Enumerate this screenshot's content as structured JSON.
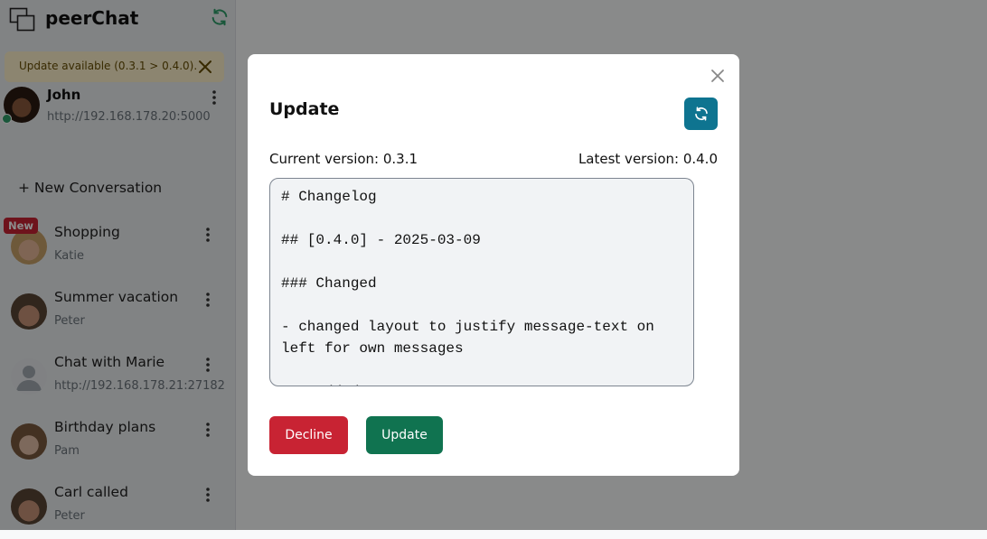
{
  "app": {
    "title": "peerChat"
  },
  "banner": {
    "text": "Update available (0.3.1 > 0.4.0)."
  },
  "profile": {
    "name": "John",
    "url": "http://192.168.178.20:5000"
  },
  "sidebar": {
    "new_conversation": "+ New Conversation",
    "new_badge": "New",
    "conversations": [
      {
        "title": "Shopping",
        "subtitle": "Katie"
      },
      {
        "title": "Summer vacation",
        "subtitle": "Peter"
      },
      {
        "title": "Chat with Marie",
        "subtitle": "http://192.168.178.21:27182"
      },
      {
        "title": "Birthday plans",
        "subtitle": "Pam"
      },
      {
        "title": "Carl called",
        "subtitle": "Peter"
      }
    ]
  },
  "modal": {
    "title": "Update",
    "current_version": "Current version: 0.3.1",
    "latest_version": "Latest version: 0.4.0",
    "changelog": "# Changelog\n\n## [0.4.0] - 2025-03-09\n\n### Changed\n\n- changed layout to justify message-text on left for own messages\n\n### Added",
    "decline_label": "Decline",
    "update_label": "Update"
  },
  "colors": {
    "accent": "#0e7490",
    "decline": "#c82333",
    "update": "#107350",
    "online": "#2f9e6b",
    "banner_bg": "#fff3cd"
  },
  "icons": {
    "logo": "chat-windows-icon",
    "refresh": "refresh-icon",
    "close": "close-icon",
    "menu": "kebab-menu-icon",
    "avatar_placeholder": "person-icon"
  }
}
